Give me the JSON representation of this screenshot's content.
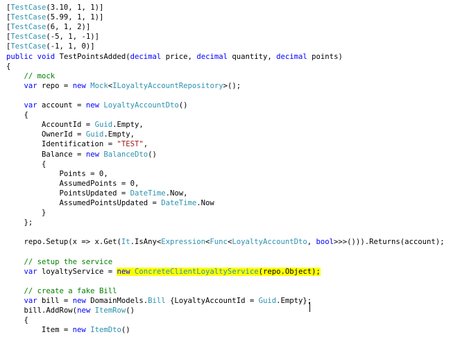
{
  "colors": {
    "keyword": "#0000ff",
    "type": "#2b91af",
    "string": "#a31515",
    "comment": "#008000",
    "plain": "#000000",
    "highlight": "#ffff00",
    "background": "#ffffff"
  },
  "code_lines": [
    [
      [
        "p",
        "["
      ],
      [
        "t",
        "TestCase"
      ],
      [
        "p",
        "(3.10, 1, 1)]"
      ]
    ],
    [
      [
        "p",
        "["
      ],
      [
        "t",
        "TestCase"
      ],
      [
        "p",
        "(5.99, 1, 1)]"
      ]
    ],
    [
      [
        "p",
        "["
      ],
      [
        "t",
        "TestCase"
      ],
      [
        "p",
        "(6, 1, 2)]"
      ]
    ],
    [
      [
        "p",
        "["
      ],
      [
        "t",
        "TestCase"
      ],
      [
        "p",
        "(-5, 1, -1)]"
      ]
    ],
    [
      [
        "p",
        "["
      ],
      [
        "t",
        "TestCase"
      ],
      [
        "p",
        "(-1, 1, 0)]"
      ]
    ],
    [
      [
        "k",
        "public"
      ],
      [
        "p",
        " "
      ],
      [
        "k",
        "void"
      ],
      [
        "p",
        " TestPointsAdded("
      ],
      [
        "k",
        "decimal"
      ],
      [
        "p",
        " price, "
      ],
      [
        "k",
        "decimal"
      ],
      [
        "p",
        " quantity, "
      ],
      [
        "k",
        "decimal"
      ],
      [
        "p",
        " points)"
      ]
    ],
    [
      [
        "p",
        "{"
      ]
    ],
    [
      [
        "p",
        "    "
      ],
      [
        "c",
        "// mock"
      ]
    ],
    [
      [
        "p",
        "    "
      ],
      [
        "k",
        "var"
      ],
      [
        "p",
        " repo = "
      ],
      [
        "k",
        "new"
      ],
      [
        "p",
        " "
      ],
      [
        "t",
        "Mock"
      ],
      [
        "p",
        "<"
      ],
      [
        "t",
        "ILoyaltyAccountRepository"
      ],
      [
        "p",
        ">();"
      ]
    ],
    [
      [
        "p",
        ""
      ]
    ],
    [
      [
        "p",
        "    "
      ],
      [
        "k",
        "var"
      ],
      [
        "p",
        " account = "
      ],
      [
        "k",
        "new"
      ],
      [
        "p",
        " "
      ],
      [
        "t",
        "LoyaltyAccountDto"
      ],
      [
        "p",
        "()"
      ]
    ],
    [
      [
        "p",
        "    {"
      ]
    ],
    [
      [
        "p",
        "        AccountId = "
      ],
      [
        "t",
        "Guid"
      ],
      [
        "p",
        ".Empty,"
      ]
    ],
    [
      [
        "p",
        "        OwnerId = "
      ],
      [
        "t",
        "Guid"
      ],
      [
        "p",
        ".Empty,"
      ]
    ],
    [
      [
        "p",
        "        Identification = "
      ],
      [
        "s",
        "\"TEST\""
      ],
      [
        "p",
        ","
      ]
    ],
    [
      [
        "p",
        "        Balance = "
      ],
      [
        "k",
        "new"
      ],
      [
        "p",
        " "
      ],
      [
        "t",
        "BalanceDto"
      ],
      [
        "p",
        "()"
      ]
    ],
    [
      [
        "p",
        "        {"
      ]
    ],
    [
      [
        "p",
        "            Points = 0,"
      ]
    ],
    [
      [
        "p",
        "            AssumedPoints = 0,"
      ]
    ],
    [
      [
        "p",
        "            PointsUpdated = "
      ],
      [
        "t",
        "DateTime"
      ],
      [
        "p",
        ".Now,"
      ]
    ],
    [
      [
        "p",
        "            AssumedPointsUpdated = "
      ],
      [
        "t",
        "DateTime"
      ],
      [
        "p",
        ".Now"
      ]
    ],
    [
      [
        "p",
        "        }"
      ]
    ],
    [
      [
        "p",
        "    };"
      ]
    ],
    [
      [
        "p",
        ""
      ]
    ],
    [
      [
        "p",
        "    repo.Setup(x => x.Get("
      ],
      [
        "t",
        "It"
      ],
      [
        "p",
        ".IsAny<"
      ],
      [
        "t",
        "Expression"
      ],
      [
        "p",
        "<"
      ],
      [
        "t",
        "Func"
      ],
      [
        "p",
        "<"
      ],
      [
        "t",
        "LoyaltyAccountDto"
      ],
      [
        "p",
        ", "
      ],
      [
        "k",
        "bool"
      ],
      [
        "p",
        ">>>())).Returns(account);"
      ]
    ],
    [
      [
        "p",
        ""
      ]
    ],
    [
      [
        "p",
        "    "
      ],
      [
        "c",
        "// setup the service"
      ]
    ],
    [
      [
        "p",
        "    "
      ],
      [
        "k",
        "var"
      ],
      [
        "p",
        " loyaltyService = "
      ],
      [
        "hk",
        "new"
      ],
      [
        "hp",
        " "
      ],
      [
        "ht",
        "ConcreteClientLoyaltyService"
      ],
      [
        "hp",
        "(repo.Object);"
      ]
    ],
    [
      [
        "p",
        ""
      ]
    ],
    [
      [
        "p",
        "    "
      ],
      [
        "c",
        "// create a fake Bill"
      ]
    ],
    [
      [
        "p",
        "    "
      ],
      [
        "k",
        "var"
      ],
      [
        "p",
        " bill = "
      ],
      [
        "k",
        "new"
      ],
      [
        "p",
        " DomainModels."
      ],
      [
        "t",
        "Bill"
      ],
      [
        "p",
        " {LoyaltyAccountId = "
      ],
      [
        "t",
        "Guid"
      ],
      [
        "p",
        ".Empty};"
      ]
    ],
    [
      [
        "p",
        "    bill.AddRow("
      ],
      [
        "k",
        "new"
      ],
      [
        "p",
        " "
      ],
      [
        "t",
        "ItemRow"
      ],
      [
        "p",
        "()"
      ]
    ],
    [
      [
        "p",
        "    {"
      ]
    ],
    [
      [
        "p",
        "        Item = "
      ],
      [
        "k",
        "new"
      ],
      [
        "p",
        " "
      ],
      [
        "t",
        "ItemDto"
      ],
      [
        "p",
        "()"
      ]
    ]
  ]
}
